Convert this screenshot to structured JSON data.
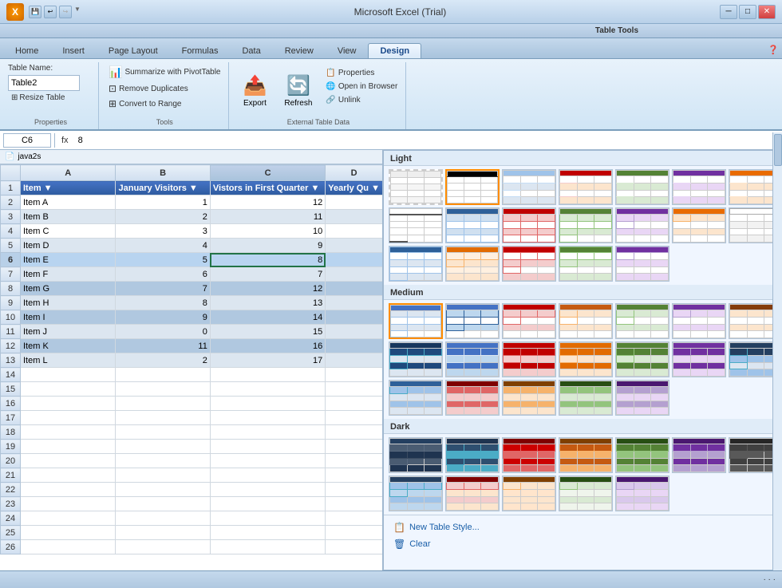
{
  "app": {
    "title": "Microsoft Excel (Trial)",
    "table_tools_label": "Table Tools"
  },
  "ribbon_tabs": {
    "main_tabs": [
      "Home",
      "Insert",
      "Page Layout",
      "Formulas",
      "Data",
      "Review",
      "View"
    ],
    "active_tab": "Design",
    "context_tab": "Design"
  },
  "ribbon": {
    "properties_group": {
      "label": "Properties",
      "table_name_label": "Table Name:",
      "table_name_value": "Table2",
      "resize_table_label": "Resize Table"
    },
    "tools_group": {
      "label": "Tools",
      "summarize_btn": "Summarize with PivotTable",
      "remove_duplicates_btn": "Remove Duplicates",
      "convert_range_btn": "Convert to Range"
    },
    "export_group": {
      "label": "External Table Data",
      "export_btn": "Export",
      "refresh_btn": "Refresh",
      "properties_btn": "Properties",
      "open_browser_btn": "Open in Browser",
      "unlink_btn": "Unlink"
    }
  },
  "formula_bar": {
    "cell_ref": "C6",
    "formula": "8"
  },
  "java2s_label": "java2s",
  "columns": [
    "A",
    "B",
    "C",
    "D"
  ],
  "rows": [
    1,
    2,
    3,
    4,
    5,
    6,
    7,
    8,
    9,
    10,
    11,
    12,
    13,
    14,
    15,
    16,
    17,
    18,
    19,
    20,
    21,
    22,
    23,
    24,
    25,
    26
  ],
  "headers": [
    "Item",
    "January Visitors",
    "Vistors in First Quarter",
    "Yearly Qu"
  ],
  "data": [
    [
      "Item A",
      "1",
      "12",
      ""
    ],
    [
      "Item B",
      "2",
      "11",
      ""
    ],
    [
      "Item C",
      "3",
      "10",
      ""
    ],
    [
      "Item D",
      "4",
      "9",
      ""
    ],
    [
      "Item E",
      "5",
      "8",
      ""
    ],
    [
      "Item F",
      "6",
      "7",
      ""
    ],
    [
      "Item G",
      "7",
      "12",
      ""
    ],
    [
      "Item H",
      "8",
      "13",
      ""
    ],
    [
      "Item I",
      "9",
      "14",
      ""
    ],
    [
      "Item J",
      "0",
      "15",
      ""
    ],
    [
      "Item K",
      "11",
      "16",
      ""
    ],
    [
      "Item L",
      "2",
      "17",
      ""
    ]
  ],
  "active_cell": {
    "row": 6,
    "col": 3
  },
  "style_panel": {
    "sections": [
      "Light",
      "Medium",
      "Dark"
    ],
    "bottom_actions": [
      "New Table Style...",
      "Clear"
    ]
  },
  "status_bar": {
    "left": "",
    "right": "... "
  }
}
